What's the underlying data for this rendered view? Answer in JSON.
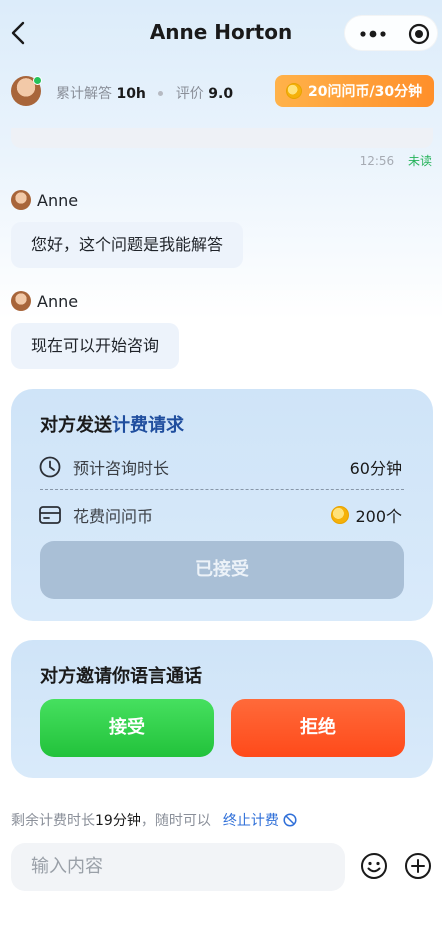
{
  "header": {
    "title": "Anne Horton"
  },
  "expert": {
    "stat_solved_label": "累计解答",
    "stat_solved_value": "10h",
    "stat_rating_label": "评价",
    "stat_rating_value": "9.0",
    "price_chip": "20问问币/30分钟"
  },
  "chat": {
    "time": "12:56",
    "unread": "未读",
    "messages": [
      {
        "sender": "Anne",
        "text": "您好，这个问题是我能解答"
      },
      {
        "sender": "Anne",
        "text": "现在可以开始咨询"
      }
    ]
  },
  "billing_card": {
    "title_prefix": "对方发送",
    "title_accent": "计费请求",
    "duration_label": "预计咨询时长",
    "duration_value": "60分钟",
    "cost_label": "花费问问币",
    "cost_value": "200个",
    "status_button": "已接受"
  },
  "call_card": {
    "title": "对方邀请你语言通话",
    "accept_label": "接受",
    "reject_label": "拒绝"
  },
  "footer": {
    "remain_prefix": "剩余计费时长",
    "remain_value": "19分钟",
    "remain_suffix": "，随时可以",
    "stop_link": "终止计费",
    "input_placeholder": "输入内容"
  },
  "colors": {
    "accent_blue": "#1f4e9e",
    "accept_green": "#22c23b",
    "reject_orange": "#ff4a1a",
    "coin_chip_orange": "#ff8f2a",
    "online_green": "#25c25a"
  }
}
